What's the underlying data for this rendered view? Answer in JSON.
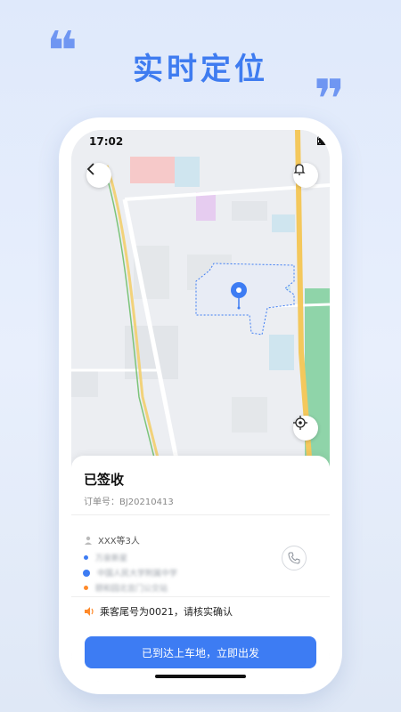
{
  "promo": {
    "title": "实时定位"
  },
  "status_bar": {
    "time": "17:02"
  },
  "sheet": {
    "status_title": "已签收",
    "order_number": "订单号：BJ20210413",
    "passengers": "XXX等3人",
    "stops": [
      {
        "label": "万泉新星",
        "dot_color": "#3d7cf3",
        "icon": "dot"
      },
      {
        "label": "中国人民大学附属中学",
        "dot_color": "#3d7cf3",
        "icon": "metro"
      },
      {
        "label": "颐和园北宫门公交站",
        "dot_color": "#ff8a2a",
        "icon": "dot"
      }
    ],
    "notice": "乘客尾号为0021，请核实确认",
    "action_button": "已到达上车地，立即出发"
  },
  "colors": {
    "accent": "#3d7cf3",
    "promo_title": "#3f7cf0",
    "quote": "#6f96f2",
    "warning": "#ff8a2a"
  }
}
